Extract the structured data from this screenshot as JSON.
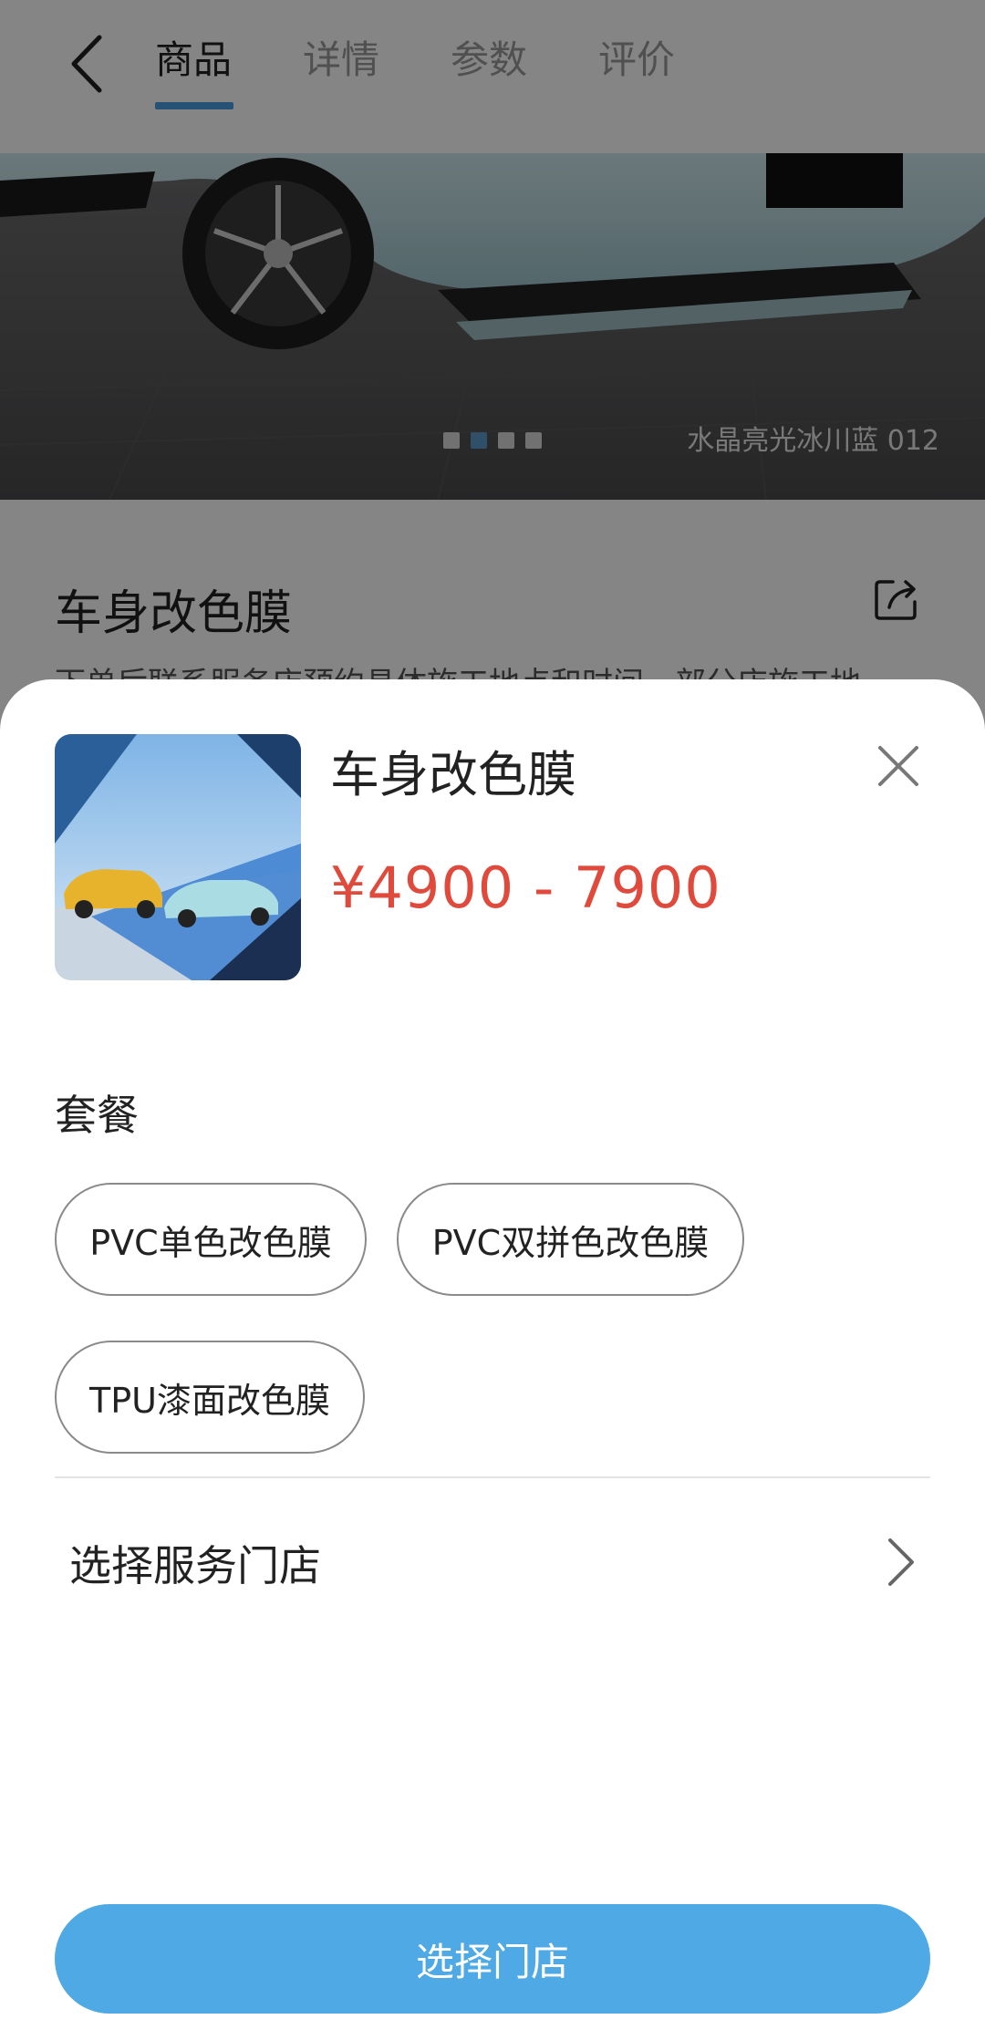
{
  "header": {
    "back_icon": "chevron-left-icon",
    "tabs": [
      {
        "label": "商品",
        "active": true
      },
      {
        "label": "详情",
        "active": false
      },
      {
        "label": "参数",
        "active": false
      },
      {
        "label": "评价",
        "active": false
      }
    ]
  },
  "gallery": {
    "caption": "水晶亮光冰川蓝 012",
    "slide_count": 4,
    "active_slide": 2
  },
  "product": {
    "title": "车身改色膜",
    "description": "下单后联系服务店预约具体施工地点和时间，部分店施工地",
    "share_icon": "share-icon"
  },
  "sheet": {
    "title": "车身改色膜",
    "price": "¥4900 - 7900",
    "close_icon": "close-icon",
    "package_label": "套餐",
    "packages": [
      {
        "label": "PVC单色改色膜"
      },
      {
        "label": "PVC双拼色改色膜"
      },
      {
        "label": "TPU漆面改色膜"
      }
    ],
    "store_row_label": "选择服务门店",
    "store_row_icon": "chevron-right-icon",
    "cta_label": "选择门店"
  },
  "colors": {
    "accent": "#4ea9e4",
    "price": "#e04a3c",
    "tab_indicator": "#4a9fe0"
  }
}
